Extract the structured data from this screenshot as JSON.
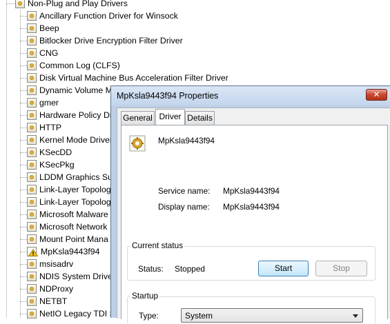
{
  "tree": {
    "category_label": "Non-Plug and Play Drivers",
    "drivers": [
      {
        "name": "Ancillary Function Driver for Winsock",
        "icon": "device-icon"
      },
      {
        "name": "Beep",
        "icon": "device-icon"
      },
      {
        "name": "Bitlocker Drive Encryption Filter Driver",
        "icon": "device-icon"
      },
      {
        "name": "CNG",
        "icon": "device-icon"
      },
      {
        "name": "Common Log (CLFS)",
        "icon": "device-icon"
      },
      {
        "name": "Disk Virtual Machine Bus Acceleration Filter Driver",
        "icon": "device-icon"
      },
      {
        "name": "Dynamic Volume M",
        "icon": "device-icon"
      },
      {
        "name": "gmer",
        "icon": "device-icon"
      },
      {
        "name": "Hardware Policy Dr",
        "icon": "device-icon"
      },
      {
        "name": "HTTP",
        "icon": "device-icon"
      },
      {
        "name": "Kernel Mode Driver",
        "icon": "device-icon"
      },
      {
        "name": "KSecDD",
        "icon": "device-icon"
      },
      {
        "name": "KSecPkg",
        "icon": "device-icon"
      },
      {
        "name": "LDDM Graphics Sul",
        "icon": "device-icon"
      },
      {
        "name": "Link-Layer Topolog",
        "icon": "device-icon"
      },
      {
        "name": "Link-Layer Topolog",
        "icon": "device-icon"
      },
      {
        "name": "Microsoft Malware",
        "icon": "device-icon"
      },
      {
        "name": "Microsoft Network",
        "icon": "device-icon"
      },
      {
        "name": "Mount Point Mana",
        "icon": "device-icon"
      },
      {
        "name": "MpKsla9443f94",
        "icon": "warning-icon"
      },
      {
        "name": "msisadrv",
        "icon": "device-icon"
      },
      {
        "name": "NDIS System Driver",
        "icon": "device-icon"
      },
      {
        "name": "NDProxy",
        "icon": "device-icon"
      },
      {
        "name": "NETBT",
        "icon": "device-icon"
      },
      {
        "name": "NetIO Legacy TDI S",
        "icon": "device-icon"
      }
    ]
  },
  "dialog": {
    "title": "MpKsla9443f94 Properties",
    "close_glyph": "✕",
    "tabs": [
      {
        "label": "General",
        "selected": false
      },
      {
        "label": "Driver",
        "selected": true
      },
      {
        "label": "Details",
        "selected": false
      }
    ],
    "service_display": "MpKsla9443f94",
    "service_name_label": "Service name:",
    "service_name_value": "MpKsla9443f94",
    "display_name_label": "Display name:",
    "display_name_value": "MpKsla9443f94",
    "current_status": {
      "title": "Current status",
      "status_label": "Status:",
      "status_value": "Stopped",
      "start_button": "Start",
      "stop_button": "Stop"
    },
    "startup": {
      "title": "Startup",
      "type_label": "Type:",
      "type_value": "System"
    }
  },
  "colors": {
    "title_bar": "#c3d5ec",
    "close_button": "#c8462f",
    "start_button_border": "#3c7fb1",
    "warning_yellow": "#f5c518"
  }
}
